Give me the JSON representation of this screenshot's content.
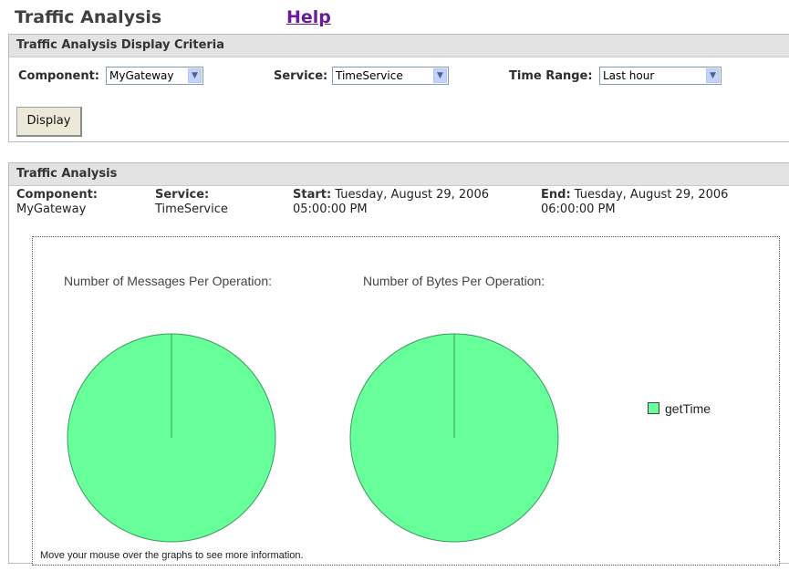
{
  "header": {
    "title": "Traffic Analysis",
    "help_link": "Help"
  },
  "criteria": {
    "title": "Traffic Analysis Display Criteria",
    "component_label": "Component:",
    "component_value": "MyGateway",
    "service_label": "Service:",
    "service_value": "TimeService",
    "time_range_label": "Time Range:",
    "time_range_value": "Last hour",
    "display_button": "Display"
  },
  "analysis": {
    "title": "Traffic Analysis",
    "component_label": "Component:",
    "component_value": "MyGateway",
    "service_label": "Service:",
    "service_value": "TimeService",
    "start_label": "Start:",
    "start_date": "Tuesday, August 29, 2006",
    "start_time": "05:00:00 PM",
    "end_label": "End:",
    "end_date": "Tuesday, August 29, 2006",
    "end_time": "06:00:00 PM",
    "footnote": "Move your mouse over the graphs to see more information."
  },
  "colors": {
    "slice": "#66ff99",
    "slice_edge": "#3c9a5c",
    "help_link": "#6a1b9a",
    "header_bar": "#e3e3e3"
  },
  "chart_data": [
    {
      "type": "pie",
      "title": "Number of Messages Per Operation:",
      "categories": [
        "getTime"
      ],
      "values": [
        100
      ],
      "legend": "right"
    },
    {
      "type": "pie",
      "title": "Number of Bytes Per Operation:",
      "categories": [
        "getTime"
      ],
      "values": [
        100
      ],
      "legend": "right"
    }
  ]
}
